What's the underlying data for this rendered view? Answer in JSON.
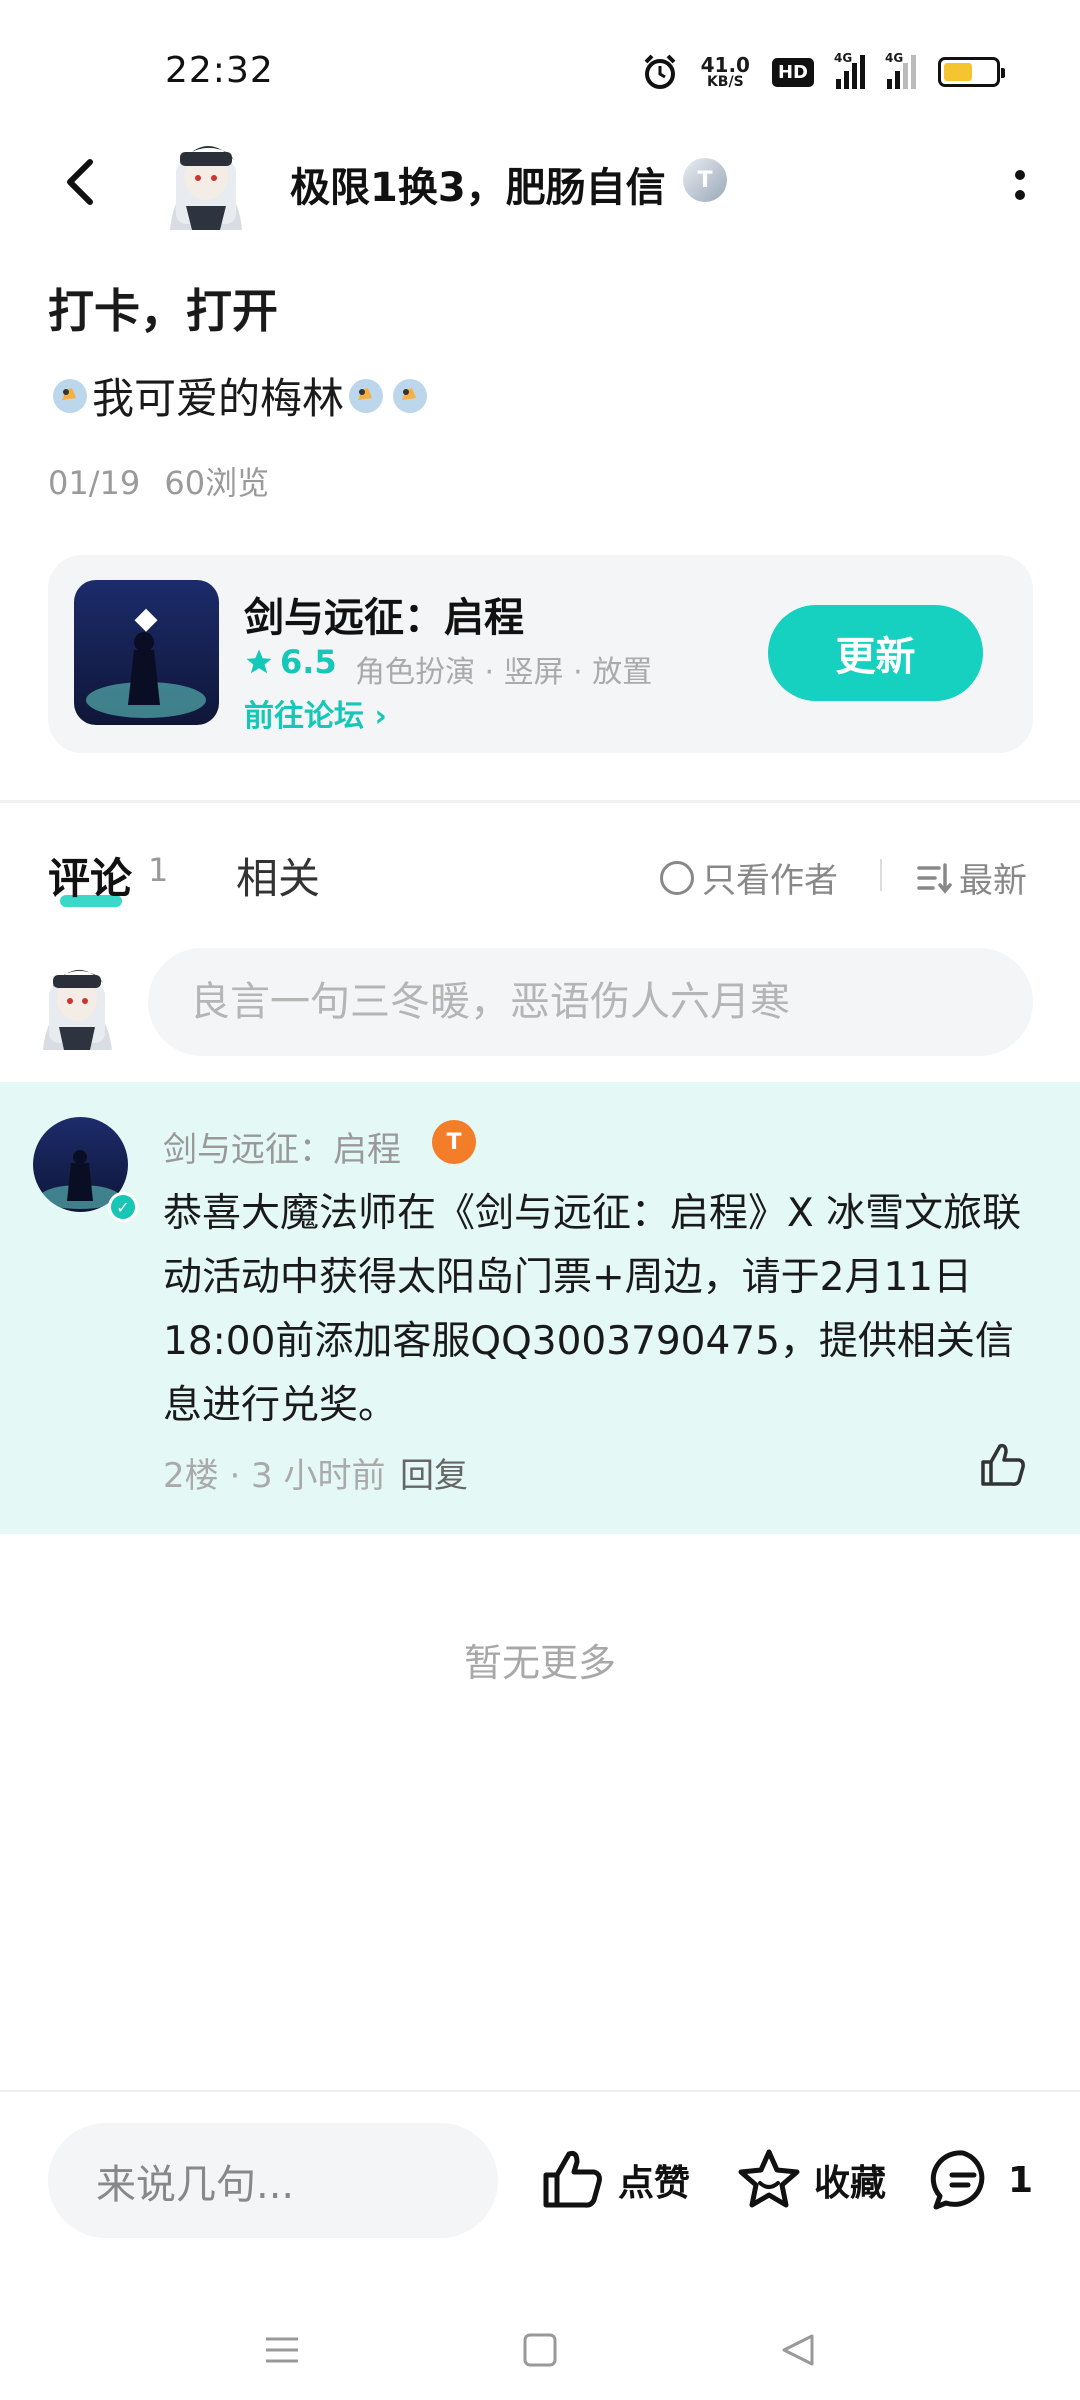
{
  "status_bar": {
    "time": "22:32",
    "net_speed_value": "41.0",
    "net_speed_unit": "KB/S",
    "hd_label": "HD",
    "signal1_label": "4G",
    "signal2_label": "4G",
    "battery_color": "#f5c431"
  },
  "header": {
    "author_name": "极限1换3，肥肠自信",
    "level_badge": "T"
  },
  "post": {
    "title": "打卡，打开",
    "body_text": "我可爱的梅林",
    "date": "01/19",
    "views": "60浏览"
  },
  "game_card": {
    "name": "剑与远征：启程",
    "rating": "6.5",
    "tags": "角色扮演 · 竖屏 · 放置",
    "forum_link": "前往论坛",
    "update_button": "更新"
  },
  "tabs": {
    "comments_label": "评论",
    "comments_count": "1",
    "related_label": "相关",
    "only_author": "只看作者",
    "sort_label": "最新"
  },
  "comment_input": {
    "placeholder": "良言一句三冬暖，恶语伤人六月寒"
  },
  "comment": {
    "author": "剑与远征：启程",
    "badge": "T",
    "text": "恭喜大魔法师在《剑与远征：启程》X 冰雪文旅联动活动中获得太阳岛门票+周边，请于2月11日18:00前添加客服QQ3003790475，提供相关信息进行兑奖。",
    "meta": "2楼 · 3 小时前",
    "reply": "回复"
  },
  "footer_note": "暂无更多",
  "bottom_bar": {
    "input_placeholder": "来说几句...",
    "like_label": "点赞",
    "favorite_label": "收藏",
    "comment_count": "1"
  },
  "colors": {
    "accent": "#17d1c0",
    "comment_highlight": "#e4f8f6"
  }
}
